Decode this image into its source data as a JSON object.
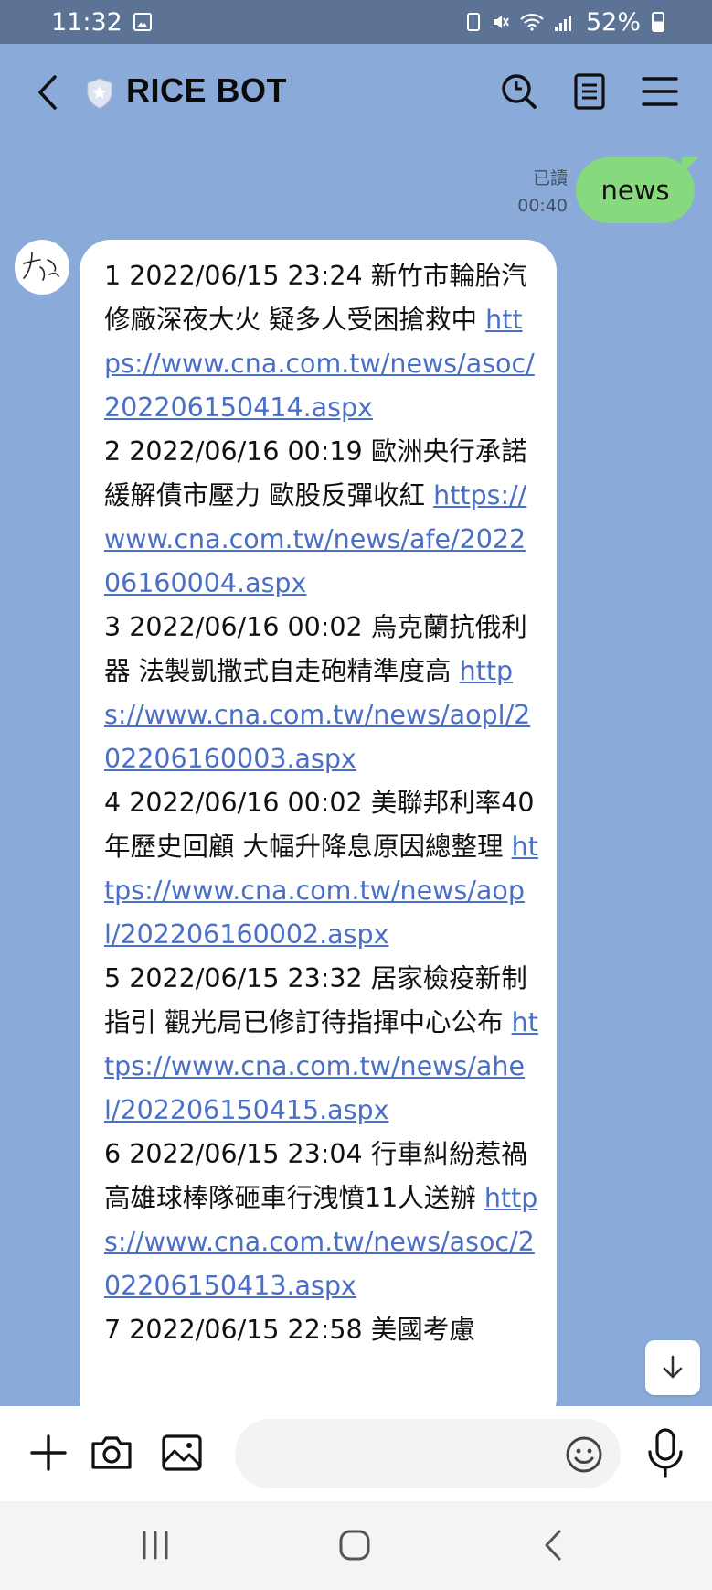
{
  "status_bar": {
    "time": "11:32",
    "battery": "52%"
  },
  "header": {
    "title": "RICE BOT"
  },
  "chat": {
    "me": {
      "read_label": "已讀",
      "time": "00:40",
      "text": "news"
    },
    "bot": {
      "items": [
        {
          "text": "1 2022/06/15 23:24 新竹市輪胎汽修廠深夜大火 疑多人受困搶救中 ",
          "link": "https://www.cna.com.tw/news/asoc/202206150414.aspx"
        },
        {
          "text": "2 2022/06/16 00:19 歐洲央行承諾緩解債市壓力 歐股反彈收紅 ",
          "link": "https://www.cna.com.tw/news/afe/202206160004.aspx"
        },
        {
          "text": "3 2022/06/16 00:02 烏克蘭抗俄利器 法製凱撒式自走砲精準度高 ",
          "link": "https://www.cna.com.tw/news/aopl/202206160003.aspx"
        },
        {
          "text": "4 2022/06/16 00:02 美聯邦利率40年歷史回顧 大幅升降息原因總整理 ",
          "link": "https://www.cna.com.tw/news/aopl/202206160002.aspx"
        },
        {
          "text": "5 2022/06/15 23:32 居家檢疫新制指引 觀光局已修訂待指揮中心公布 ",
          "link": "https://www.cna.com.tw/news/ahel/202206150415.aspx"
        },
        {
          "text": "6 2022/06/15 23:04 行車糾紛惹禍 高雄球棒隊砸車行洩憤11人送辦 ",
          "link": "https://www.cna.com.tw/news/asoc/202206150413.aspx"
        },
        {
          "text": "7 2022/06/15 22:58 美國考慮",
          "link": ""
        }
      ]
    }
  },
  "composer": {
    "placeholder": ""
  }
}
